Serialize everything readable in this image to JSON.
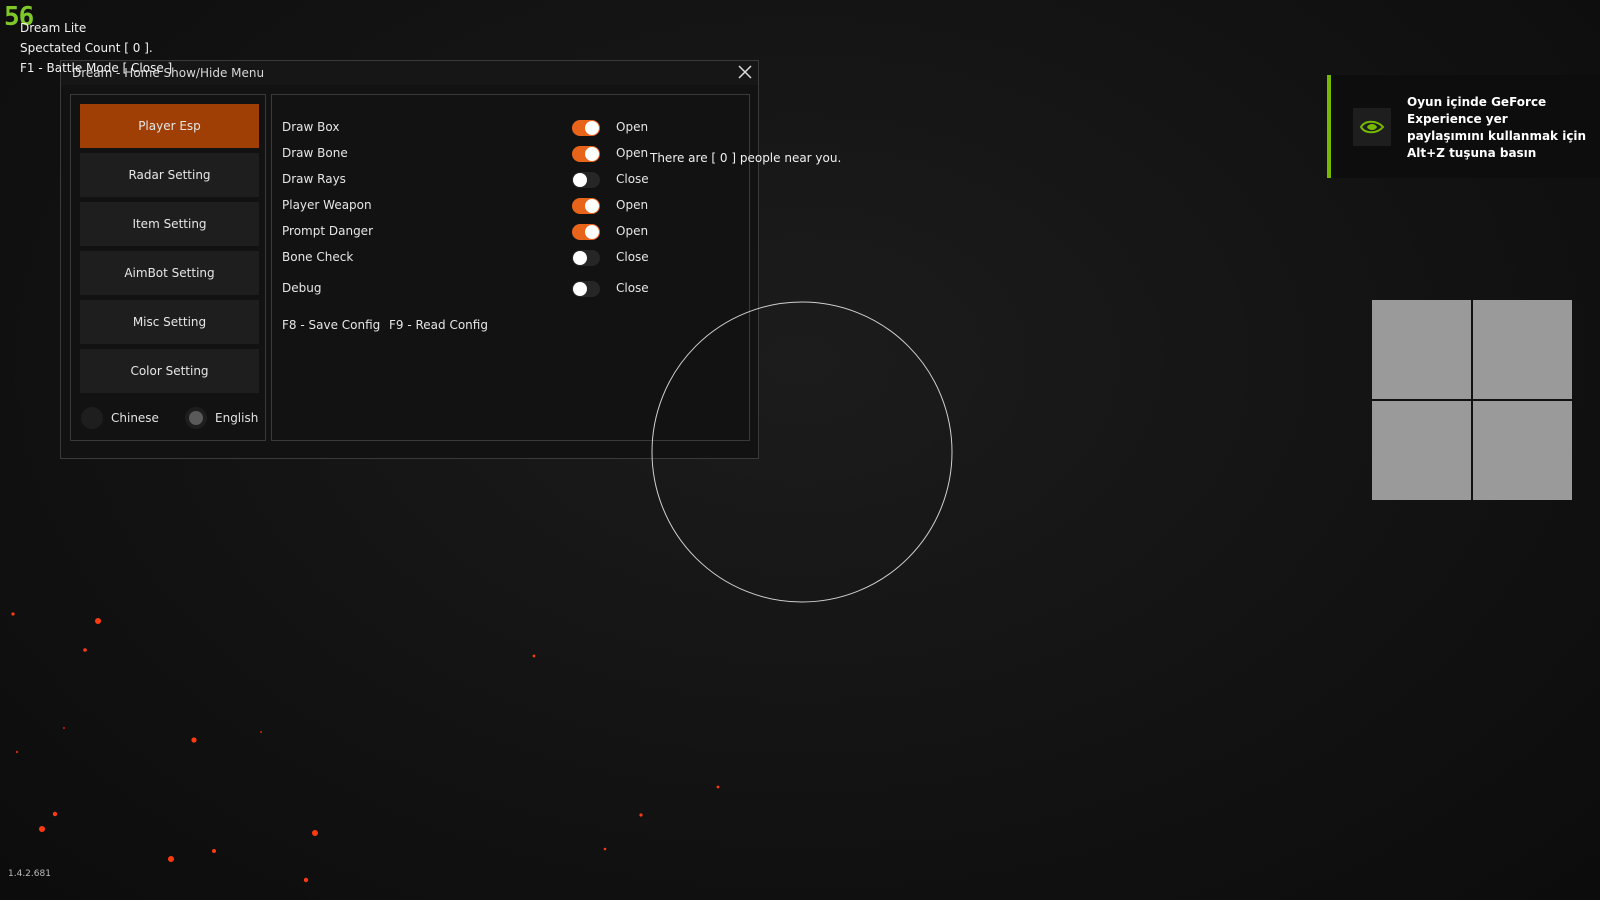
{
  "hud": {
    "fps": "56",
    "app_name": "Dream Lite",
    "spectated": "Spectated Count [ 0 ].",
    "battle_mode": "F1 - Battle Mode [ Close ]",
    "version": "1.4.2.681",
    "near_people": "There are [ 0 ] people near you."
  },
  "window": {
    "title": "Dream - Home Show/Hide Menu",
    "close_icon": "close-icon"
  },
  "sidebar": {
    "items": [
      {
        "label": "Player Esp",
        "active": true
      },
      {
        "label": "Radar Setting",
        "active": false
      },
      {
        "label": "Item Setting",
        "active": false
      },
      {
        "label": "AimBot Setting",
        "active": false
      },
      {
        "label": "Misc Setting",
        "active": false
      },
      {
        "label": "Color Setting",
        "active": false
      }
    ],
    "languages": [
      {
        "label": "Chinese",
        "selected": false
      },
      {
        "label": "English",
        "selected": true
      }
    ]
  },
  "panel": {
    "options": [
      {
        "label": "Draw Box",
        "on": true,
        "state": "Open"
      },
      {
        "label": "Draw Bone",
        "on": true,
        "state": "Open"
      },
      {
        "label": "Draw Rays",
        "on": false,
        "state": "Close"
      },
      {
        "label": "Player Weapon",
        "on": true,
        "state": "Open"
      },
      {
        "label": "Prompt Danger",
        "on": true,
        "state": "Open"
      },
      {
        "label": "Bone Check",
        "on": false,
        "state": "Close"
      },
      {
        "label": "Debug",
        "on": false,
        "state": "Close"
      }
    ],
    "save_config": "F8 - Save Config",
    "read_config": "F9 - Read Config"
  },
  "notification": {
    "text": "Oyun içinde GeForce Experience yer paylaşımını kullanmak için Alt+Z tuşuna basın",
    "icon": "nvidia-icon"
  },
  "colors": {
    "accent": "#e8641a",
    "active_tab": "#a03f05",
    "fps": "#7ec82a",
    "nvidia": "#76b900"
  }
}
